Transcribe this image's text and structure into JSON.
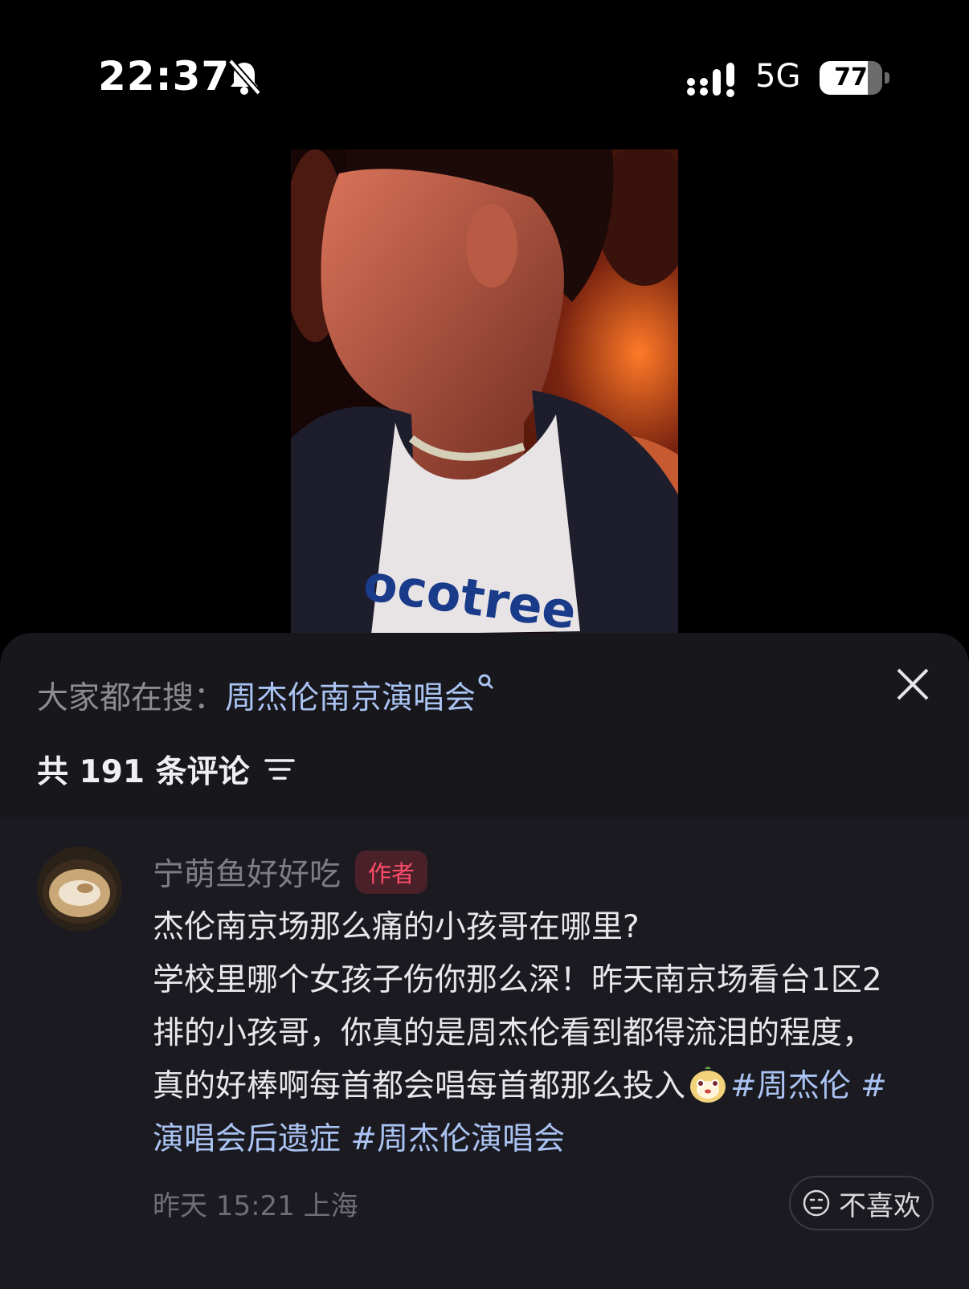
{
  "status_bar": {
    "time": "22:37",
    "network": "5G",
    "battery": "77",
    "battery_level": 0.77,
    "mute_icon": "bell-slash-icon",
    "signal_icon": "signal-bars-icon"
  },
  "video": {
    "shirt_text": "ocotree"
  },
  "comments_panel": {
    "search_label": "大家都在搜：",
    "search_term": "周杰伦南京演唱会",
    "count_text": "共 191 条评论",
    "close_icon": "close-icon",
    "sort_icon": "sort-filter-icon"
  },
  "comment": {
    "username": "宁萌鱼好好吃",
    "badge": "作者",
    "lines": [
      "杰伦南京场那么痛的小孩哥在哪里?",
      "学校里哪个女孩子伤你那么深！昨天南京场看台1区2",
      "排的小孩哥，你真的是周杰伦看到都得流泪的程度，",
      "真的好棒啊每首都会唱每首都那么投入"
    ],
    "tag1": "#周杰伦 #",
    "line5_tag_a": "演唱会后遗症",
    "line5_tag_b": "#周杰伦演唱会",
    "timestamp": "昨天 15:21 上海",
    "dislike_label": "不喜欢"
  },
  "colors": {
    "background": "#000000",
    "sheet": "#17171c",
    "link": "#aac3f2",
    "author_badge": "#ff4b6a"
  }
}
